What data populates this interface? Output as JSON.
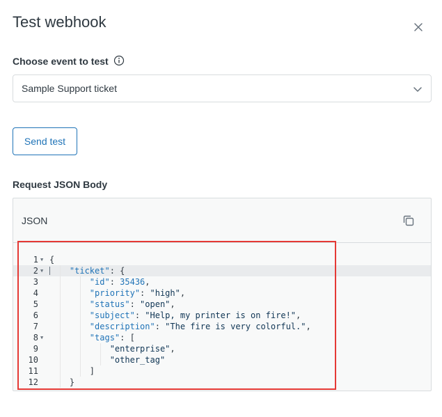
{
  "dialog": {
    "title": "Test webhook",
    "close_icon": "close-icon"
  },
  "event": {
    "label": "Choose event to test",
    "info_icon": "info-icon",
    "selected": "Sample Support ticket"
  },
  "actions": {
    "send_label": "Send test"
  },
  "request": {
    "label": "Request JSON Body",
    "panel_title": "JSON",
    "copy_icon": "copy-icon"
  },
  "code": {
    "lines": [
      {
        "num": "1",
        "fold": true,
        "tokens": [
          {
            "t": "{",
            "c": "p"
          }
        ]
      },
      {
        "num": "2",
        "fold": true,
        "active": true,
        "tokens": [
          {
            "t": "    ",
            "c": "p"
          },
          {
            "t": "\"ticket\"",
            "c": "k"
          },
          {
            "t": ": {",
            "c": "p"
          }
        ]
      },
      {
        "num": "3",
        "tokens": [
          {
            "t": "        ",
            "c": "p"
          },
          {
            "t": "\"id\"",
            "c": "k"
          },
          {
            "t": ": ",
            "c": "p"
          },
          {
            "t": "35436",
            "c": "n"
          },
          {
            "t": ",",
            "c": "p"
          }
        ]
      },
      {
        "num": "4",
        "tokens": [
          {
            "t": "        ",
            "c": "p"
          },
          {
            "t": "\"priority\"",
            "c": "k"
          },
          {
            "t": ": ",
            "c": "p"
          },
          {
            "t": "\"high\"",
            "c": "s"
          },
          {
            "t": ",",
            "c": "p"
          }
        ]
      },
      {
        "num": "5",
        "tokens": [
          {
            "t": "        ",
            "c": "p"
          },
          {
            "t": "\"status\"",
            "c": "k"
          },
          {
            "t": ": ",
            "c": "p"
          },
          {
            "t": "\"open\"",
            "c": "s"
          },
          {
            "t": ",",
            "c": "p"
          }
        ]
      },
      {
        "num": "6",
        "tokens": [
          {
            "t": "        ",
            "c": "p"
          },
          {
            "t": "\"subject\"",
            "c": "k"
          },
          {
            "t": ": ",
            "c": "p"
          },
          {
            "t": "\"Help, my printer is on fire!\"",
            "c": "s"
          },
          {
            "t": ",",
            "c": "p"
          }
        ]
      },
      {
        "num": "7",
        "tokens": [
          {
            "t": "        ",
            "c": "p"
          },
          {
            "t": "\"description\"",
            "c": "k"
          },
          {
            "t": ": ",
            "c": "p"
          },
          {
            "t": "\"The fire is very colorful.\"",
            "c": "s"
          },
          {
            "t": ",",
            "c": "p"
          }
        ]
      },
      {
        "num": "8",
        "fold": true,
        "tokens": [
          {
            "t": "        ",
            "c": "p"
          },
          {
            "t": "\"tags\"",
            "c": "k"
          },
          {
            "t": ": [",
            "c": "p"
          }
        ]
      },
      {
        "num": "9",
        "tokens": [
          {
            "t": "            ",
            "c": "p"
          },
          {
            "t": "\"enterprise\"",
            "c": "s"
          },
          {
            "t": ",",
            "c": "p"
          }
        ]
      },
      {
        "num": "10",
        "tokens": [
          {
            "t": "            ",
            "c": "p"
          },
          {
            "t": "\"other_tag\"",
            "c": "s"
          }
        ]
      },
      {
        "num": "11",
        "tokens": [
          {
            "t": "        ",
            "c": "p"
          },
          {
            "t": "]",
            "c": "p"
          }
        ]
      },
      {
        "num": "12",
        "tokens": [
          {
            "t": "    ",
            "c": "p"
          },
          {
            "t": "}",
            "c": "p"
          }
        ]
      }
    ]
  },
  "colors": {
    "accent": "#1f73b7",
    "highlight_border": "#e53935"
  }
}
